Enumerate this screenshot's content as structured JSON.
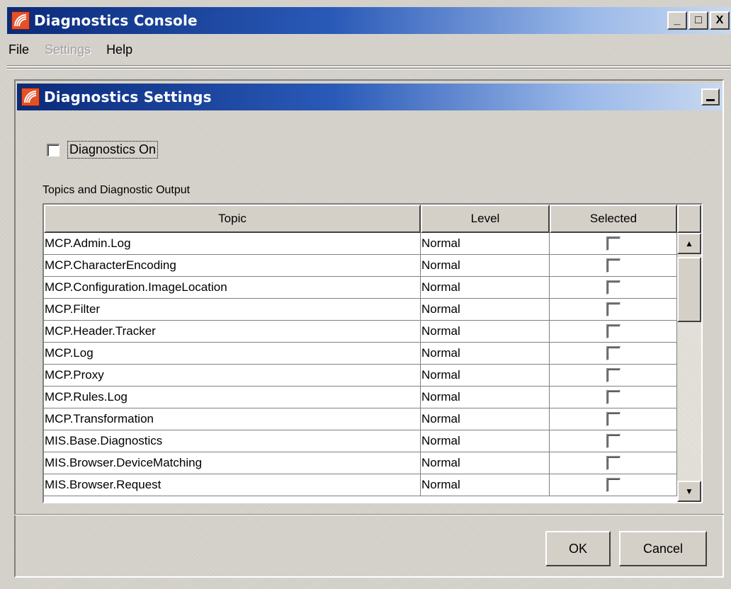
{
  "window": {
    "title": "Diagnostics Console",
    "minimize": "_",
    "maximize": "□",
    "close": "X"
  },
  "menu": [
    {
      "label": "File",
      "disabled": false
    },
    {
      "label": "Settings",
      "disabled": true
    },
    {
      "label": "Help",
      "disabled": false
    }
  ],
  "dialog": {
    "title": "Diagnostics Settings",
    "minimize": "_",
    "diagnostics_on_label": "Diagnostics On",
    "diagnostics_on_checked": false,
    "section_label": "Topics and Diagnostic Output",
    "columns": [
      "Topic",
      "Level",
      "Selected"
    ],
    "rows": [
      {
        "topic": "MCP.Admin.Log",
        "level": "Normal",
        "selected": false
      },
      {
        "topic": "MCP.CharacterEncoding",
        "level": "Normal",
        "selected": false
      },
      {
        "topic": "MCP.Configuration.ImageLocation",
        "level": "Normal",
        "selected": false
      },
      {
        "topic": "MCP.Filter",
        "level": "Normal",
        "selected": false
      },
      {
        "topic": "MCP.Header.Tracker",
        "level": "Normal",
        "selected": false
      },
      {
        "topic": "MCP.Log",
        "level": "Normal",
        "selected": false
      },
      {
        "topic": "MCP.Proxy",
        "level": "Normal",
        "selected": false
      },
      {
        "topic": "MCP.Rules.Log",
        "level": "Normal",
        "selected": false
      },
      {
        "topic": "MCP.Transformation",
        "level": "Normal",
        "selected": false
      },
      {
        "topic": "MIS.Base.Diagnostics",
        "level": "Normal",
        "selected": false
      },
      {
        "topic": "MIS.Browser.DeviceMatching",
        "level": "Normal",
        "selected": false
      },
      {
        "topic": "MIS.Browser.Request",
        "level": "Normal",
        "selected": false
      }
    ],
    "scroll_up": "▲",
    "scroll_down": "▼",
    "ok_label": "OK",
    "cancel_label": "Cancel"
  }
}
